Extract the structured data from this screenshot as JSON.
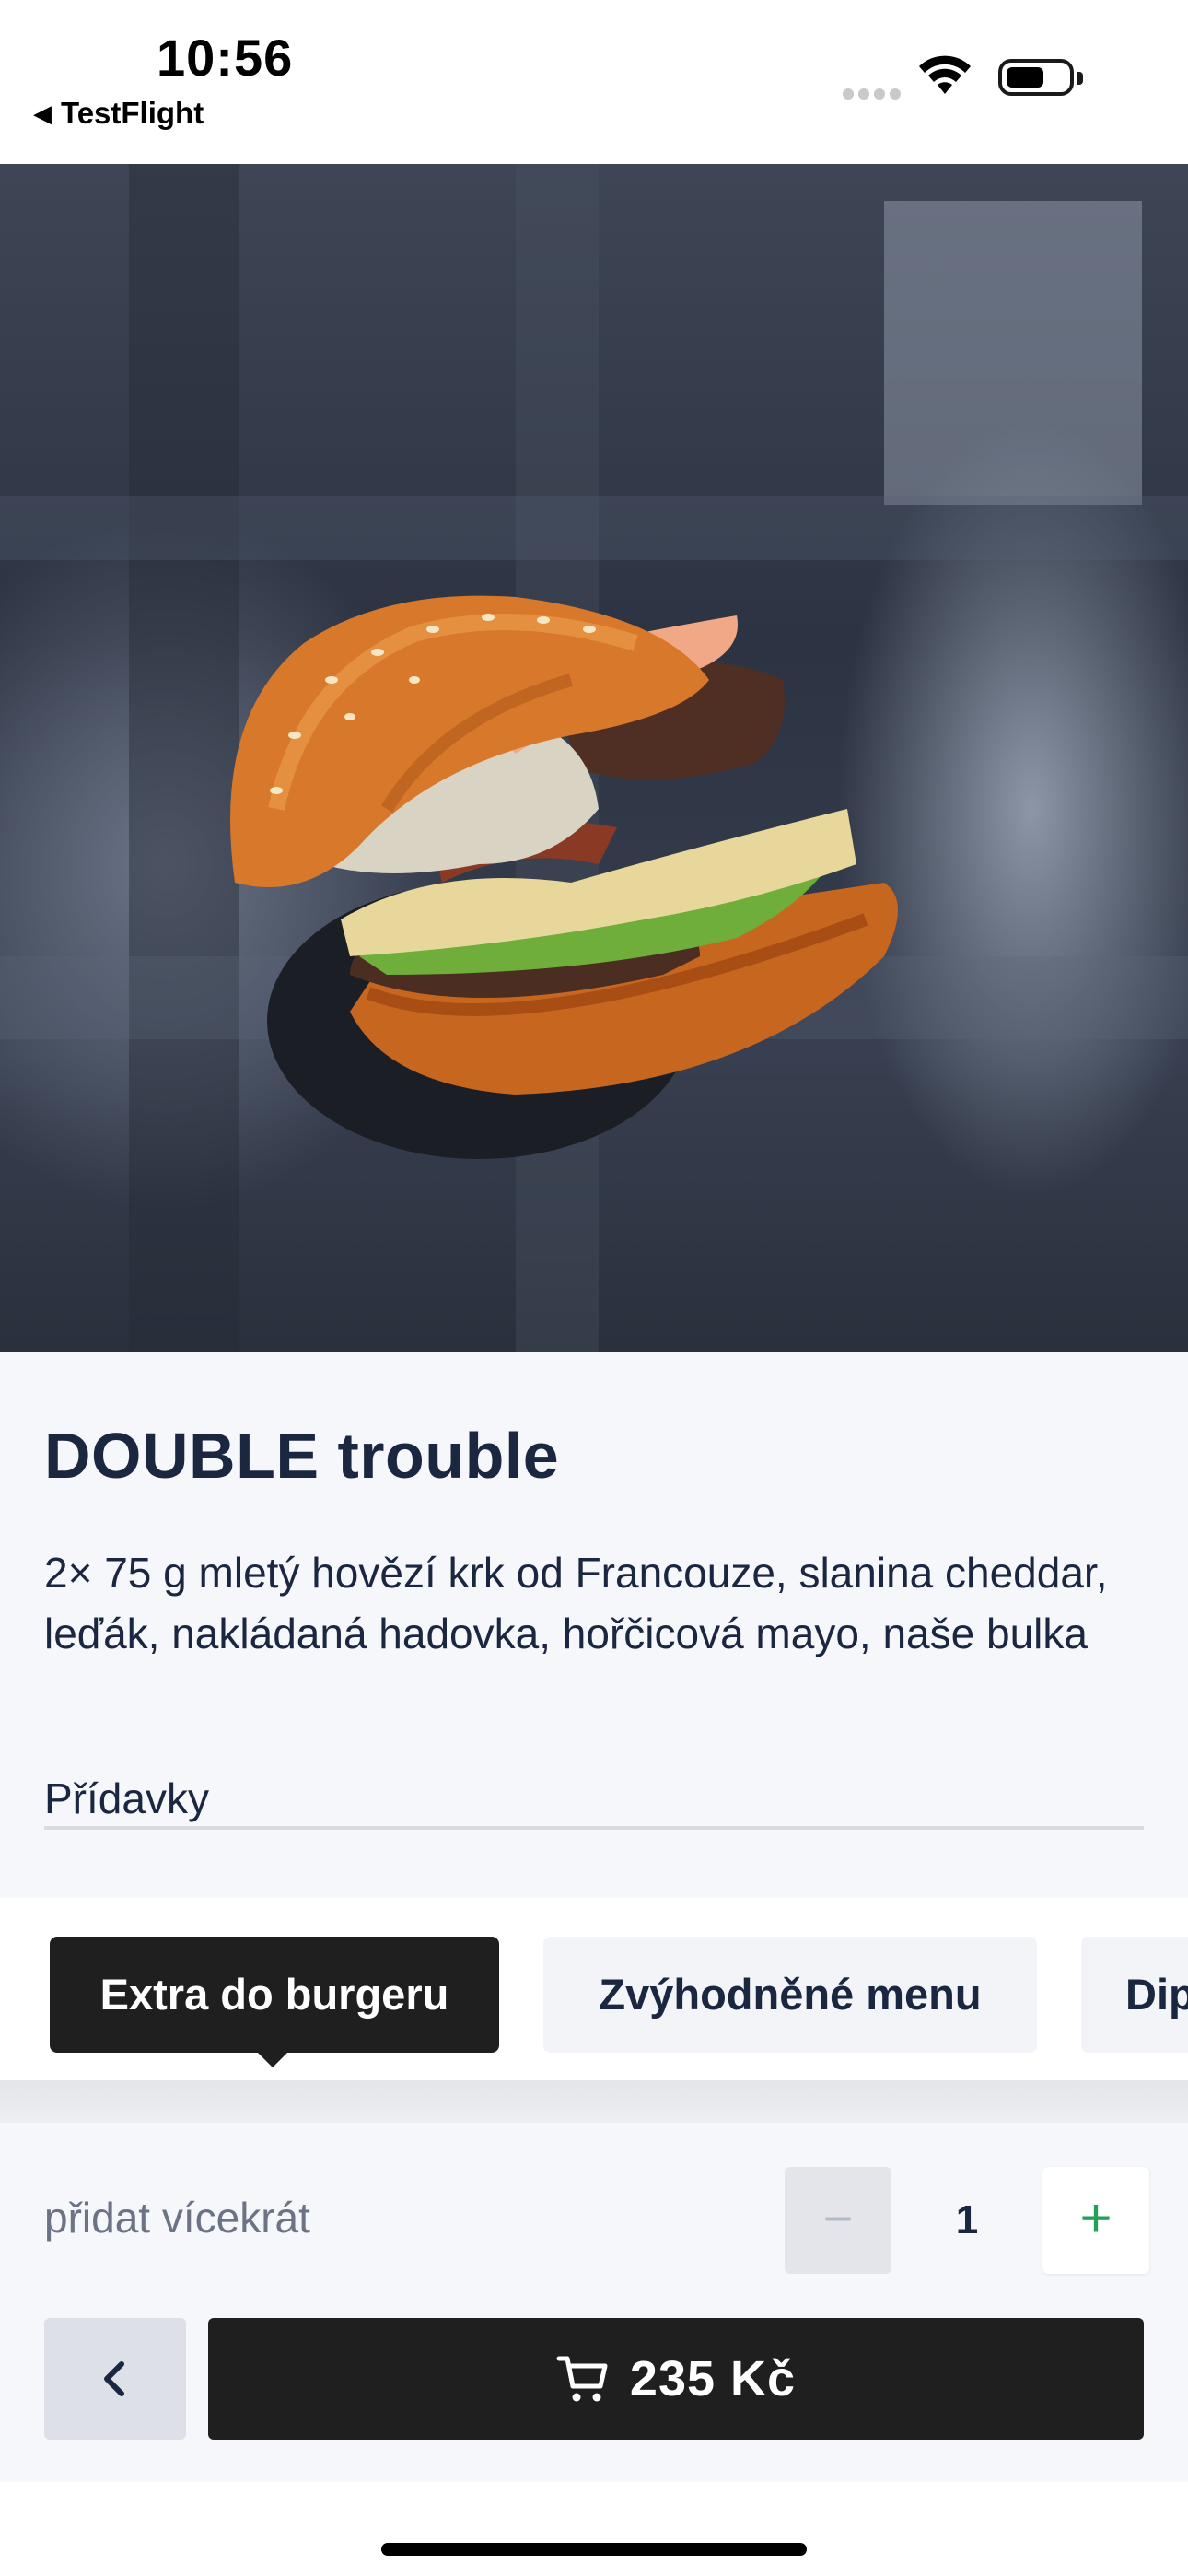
{
  "status_bar": {
    "time": "10:56",
    "back_app": "TestFlight",
    "icons": [
      "signal-icon",
      "wifi-icon",
      "battery-icon"
    ]
  },
  "hero": {
    "icon": "burger-photo"
  },
  "product": {
    "title": "DOUBLE trouble",
    "description": "2× 75 g mletý hovězí krk od Francouze, slanina cheddar, leďák, nakládaná hadovka, hořčicová mayo, naše bulka",
    "addons_label": "Přídavky"
  },
  "tabs": [
    {
      "label": "Extra do burgeru",
      "active": true
    },
    {
      "label": "Zvýhodněné menu",
      "active": false
    },
    {
      "label": "Dip",
      "active": false
    }
  ],
  "quantity": {
    "label": "přidat vícekrát",
    "minus": "−",
    "value": "1",
    "plus": "+"
  },
  "actions": {
    "back_icon": "chevron-left-icon",
    "cart_icon": "cart-icon",
    "price": "235 Kč"
  },
  "colors": {
    "primary_dark": "#1f1f1f",
    "text": "#1b2640",
    "accent_green": "#22a05a",
    "background": "#f6f7fa"
  }
}
